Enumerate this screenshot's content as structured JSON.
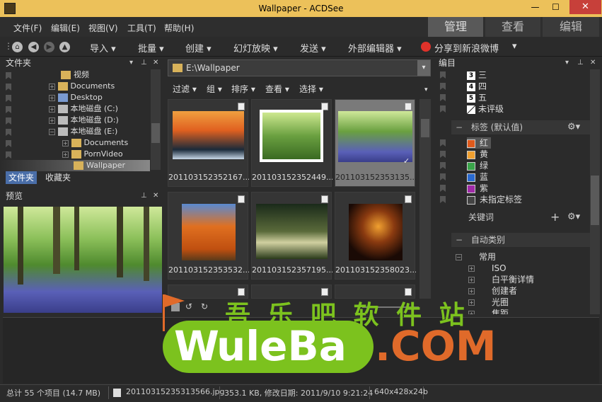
{
  "window": {
    "title": "Wallpaper - ACDSee",
    "minimize": "—",
    "maximize": "☐",
    "close": "✕"
  },
  "menu": [
    "文件(F)",
    "编辑(E)",
    "视图(V)",
    "工具(T)",
    "帮助(H)"
  ],
  "modes": [
    "管理",
    "查看",
    "编辑"
  ],
  "toolbar": {
    "items": [
      "导入",
      "批量",
      "创建",
      "幻灯放映",
      "发送",
      "外部编辑器"
    ],
    "share": "分享到新浪微博"
  },
  "folders": {
    "title": "文件夹",
    "items": [
      "视频",
      "Documents",
      "Desktop",
      "本地磁盘 (C:)",
      "本地磁盘 (D:)",
      "本地磁盘 (E:)",
      "Documents",
      "PornVideo",
      "Wallpaper"
    ],
    "tabs": [
      "文件夹",
      "收藏夹"
    ]
  },
  "preview": {
    "title": "预览"
  },
  "browser": {
    "path": "E:\\Wallpaper",
    "filters": [
      "过滤",
      "组",
      "排序",
      "查看",
      "选择"
    ],
    "thumbnails": [
      "201103152352167...",
      "201103152352449...",
      "201103152353135...",
      "201103152353532...",
      "201103152357195...",
      "201103152358023..."
    ]
  },
  "catalog": {
    "title": "编目",
    "ratings": [
      {
        "num": "3",
        "label": "三"
      },
      {
        "num": "4",
        "label": "四"
      },
      {
        "num": "5",
        "label": "五"
      },
      {
        "num": "",
        "label": "未评级"
      }
    ],
    "labels_title": "标签 (默认值)",
    "labels": [
      {
        "name": "红",
        "color": "#e05a1c"
      },
      {
        "name": "黄",
        "color": "#f0a030"
      },
      {
        "name": "绿",
        "color": "#3aa54a"
      },
      {
        "name": "蓝",
        "color": "#2a6ad0"
      },
      {
        "name": "紫",
        "color": "#a02aa8"
      },
      {
        "name": "未指定标签",
        "color": "#444444"
      }
    ],
    "keywords_title": "关键词",
    "auto_title": "自动类别",
    "auto_group": "常用",
    "auto_items": [
      "ISO",
      "白平衡详情",
      "创建者",
      "光圈",
      "焦距"
    ]
  },
  "watermark": {
    "cn": "吾 乐 吧 软 件 站",
    "brand_w": "W",
    "brand_rest": "uleBa",
    "brand_com": ".COM"
  },
  "status": {
    "total": "总计 55 个项目 (14.7 MB)",
    "file": "20110315235313566.jpg",
    "info": "353.1 KB, 修改日期: 2011/9/10 9:21:24",
    "dims": "640x428x24b"
  }
}
